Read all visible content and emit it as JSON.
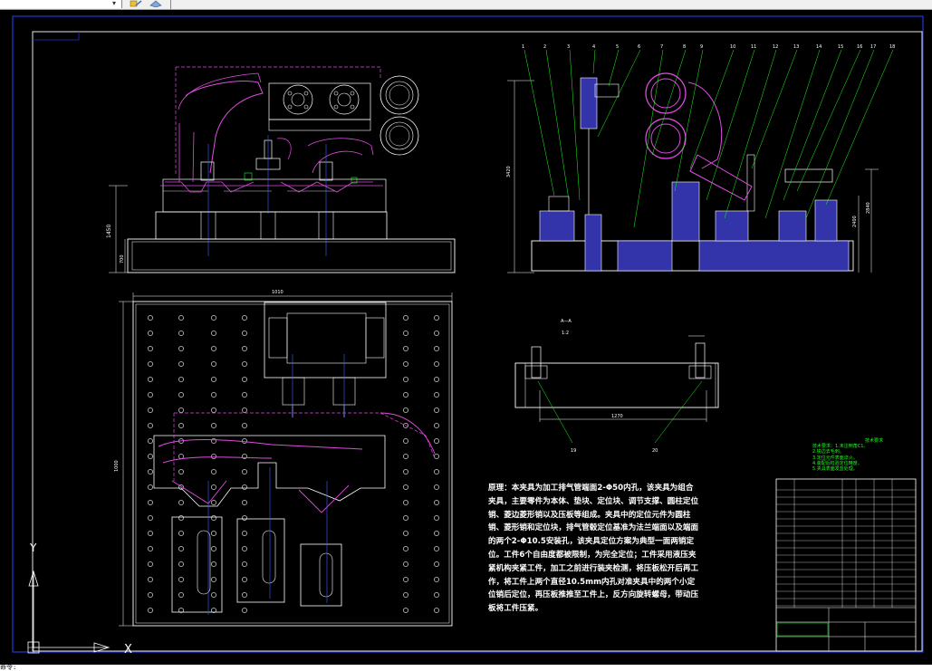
{
  "toolbar": {
    "icons": [
      "layer-tool-icon",
      "layer-state-icon"
    ]
  },
  "notes": {
    "text": "原理：本夹具为加工排气管端面2-Φ50内孔，该夹具为组合夹具，主要零件为本体、垫块、定位块、调节支撑、圆柱定位销、菱边菱形销以及压板等组成。夹具中的定位元件为圆柱销、菱形销和定位块，排气管毂定位基准为法兰端面以及端面的两个2-Φ10.5安装孔，该夹具定位方案为典型一面两销定位。工件6个自由度都被限制，为完全定位；工件采用液压夹紧机构夹紧工件，加工之前进行装夹检测，将压板松开后再工作，将工件上两个直径10.5mm内孔对准夹具中的两个小定位销后定位，再压板推推至工件上，反方向旋转螺母，带动压板将工件压紧。"
  },
  "green_notes": [
    "技术要求：1.未注倒角C1。",
    "2.锐边去毛刺。",
    "3.定位元件表面淬火。",
    "4.装配后检验定位精度。",
    "5.夹具表面发蓝处理。"
  ],
  "green_header": "技术要求",
  "balloons": [
    "1",
    "2",
    "3",
    "4",
    "5",
    "6",
    "7",
    "8",
    "9",
    "10",
    "11",
    "12",
    "13",
    "14",
    "15",
    "16",
    "17",
    "18"
  ],
  "section_label": "A—A",
  "section_scale": "1:2",
  "section_balloons": [
    "19",
    "20"
  ],
  "dims": {
    "plan_width": "1010",
    "plan_height": "1000",
    "front_h1": "1450",
    "front_h2": "700",
    "side_h": "3420",
    "side_h2": "2840",
    "side_h3": "2400",
    "section_w": "1270"
  },
  "ucs": {
    "y": "Y",
    "x": "X"
  },
  "command_line": "命令:"
}
